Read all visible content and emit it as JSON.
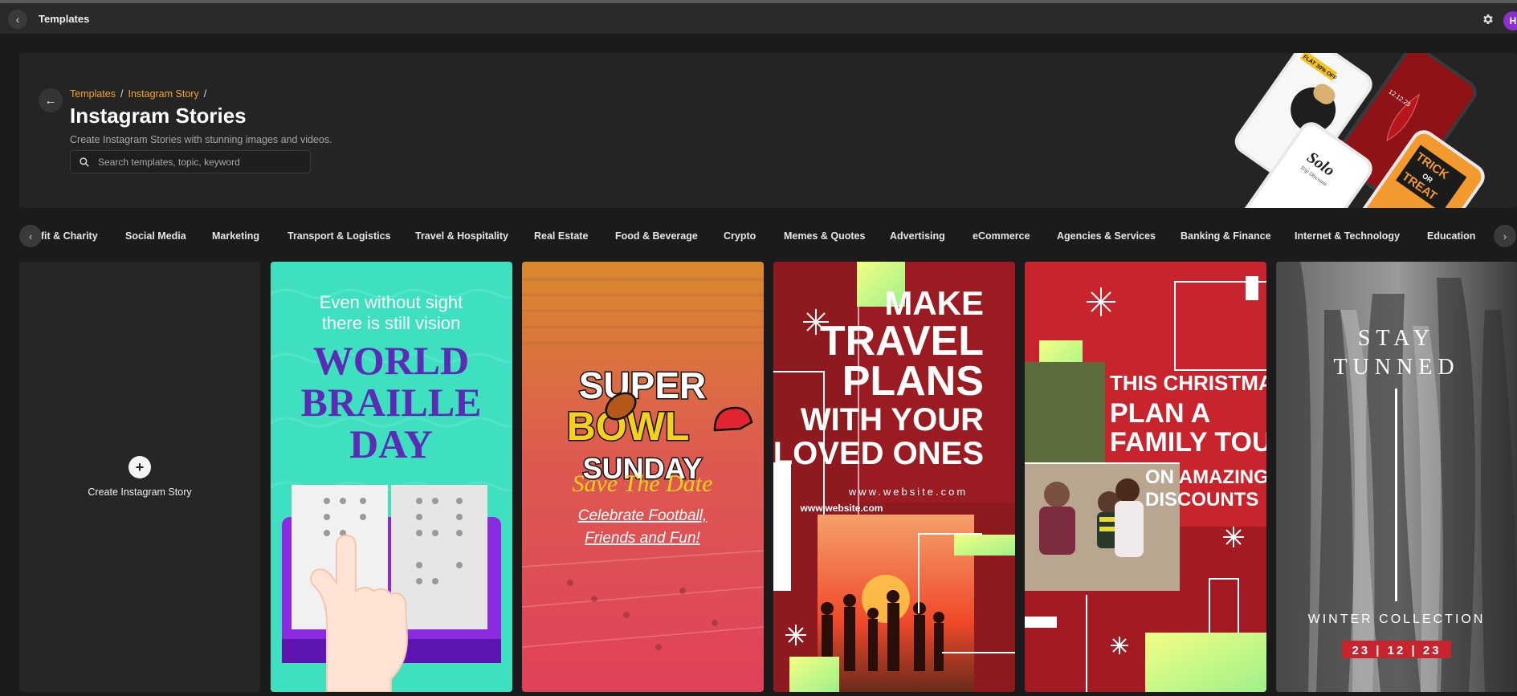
{
  "topbar": {
    "title": "Templates",
    "avatar_initial": "H"
  },
  "hero": {
    "breadcrumb": [
      "Templates",
      "Instagram Story",
      "/"
    ],
    "title": "Instagram Stories",
    "subtitle": "Create Instagram Stories with stunning images and videos.",
    "search_placeholder": "Search templates, topic, keyword",
    "phone_texts": {
      "flat": "FLAT 30% OFF",
      "date": "12.12.23",
      "solo": "Solo",
      "trip": "Trip Discount",
      "trick": "TRICK",
      "or": "OR",
      "treat": "TREAT"
    }
  },
  "categories": [
    "Profit & Charity",
    "Social Media",
    "Marketing",
    "Transport & Logistics",
    "Travel & Hospitality",
    "Real Estate",
    "Food & Beverage",
    "Crypto",
    "Memes & Quotes",
    "Advertising",
    "eCommerce",
    "Agencies & Services",
    "Banking & Finance",
    "Internet & Technology",
    "Education"
  ],
  "create_card": {
    "label": "Create Instagram Story"
  },
  "templates": {
    "braille": {
      "line1": "Even without sight",
      "line2": "there is still vision",
      "t1": "WORLD",
      "t2": "BRAILLE",
      "t3": "DAY"
    },
    "superbowl": {
      "t1": "SUPER",
      "t2": "BOWL",
      "t3": "SUNDAY",
      "script": "Save The Date",
      "sub1": "Celebrate Football,",
      "sub2": "Friends and Fun!"
    },
    "travel": {
      "t1": "MAKE",
      "t2": "TRAVEL",
      "t3": "PLANS",
      "t4": "WITH YOUR",
      "t5": "LOVED ONES",
      "site1": "www.website.com",
      "site2": "www.website.com"
    },
    "christmas": {
      "t1": "THIS CHRISTMAS",
      "t2": "PLAN A",
      "t3": "FAMILY TOUR",
      "t4": "ON AMAZING",
      "t5": "DISCOUNTS"
    },
    "winter": {
      "t1": "STAY",
      "t2": "TUNNED",
      "t3": "WINTER COLLECTION",
      "date": "23 | 12 | 23"
    }
  },
  "colors": {
    "accent": "#f4a623",
    "avatar": "#8b2fc9",
    "braille_bg": "#3fe0c0",
    "braille_purple": "#5b2bb5",
    "travel_red": "#8e1a1f",
    "christmas_red": "#c8242d"
  }
}
